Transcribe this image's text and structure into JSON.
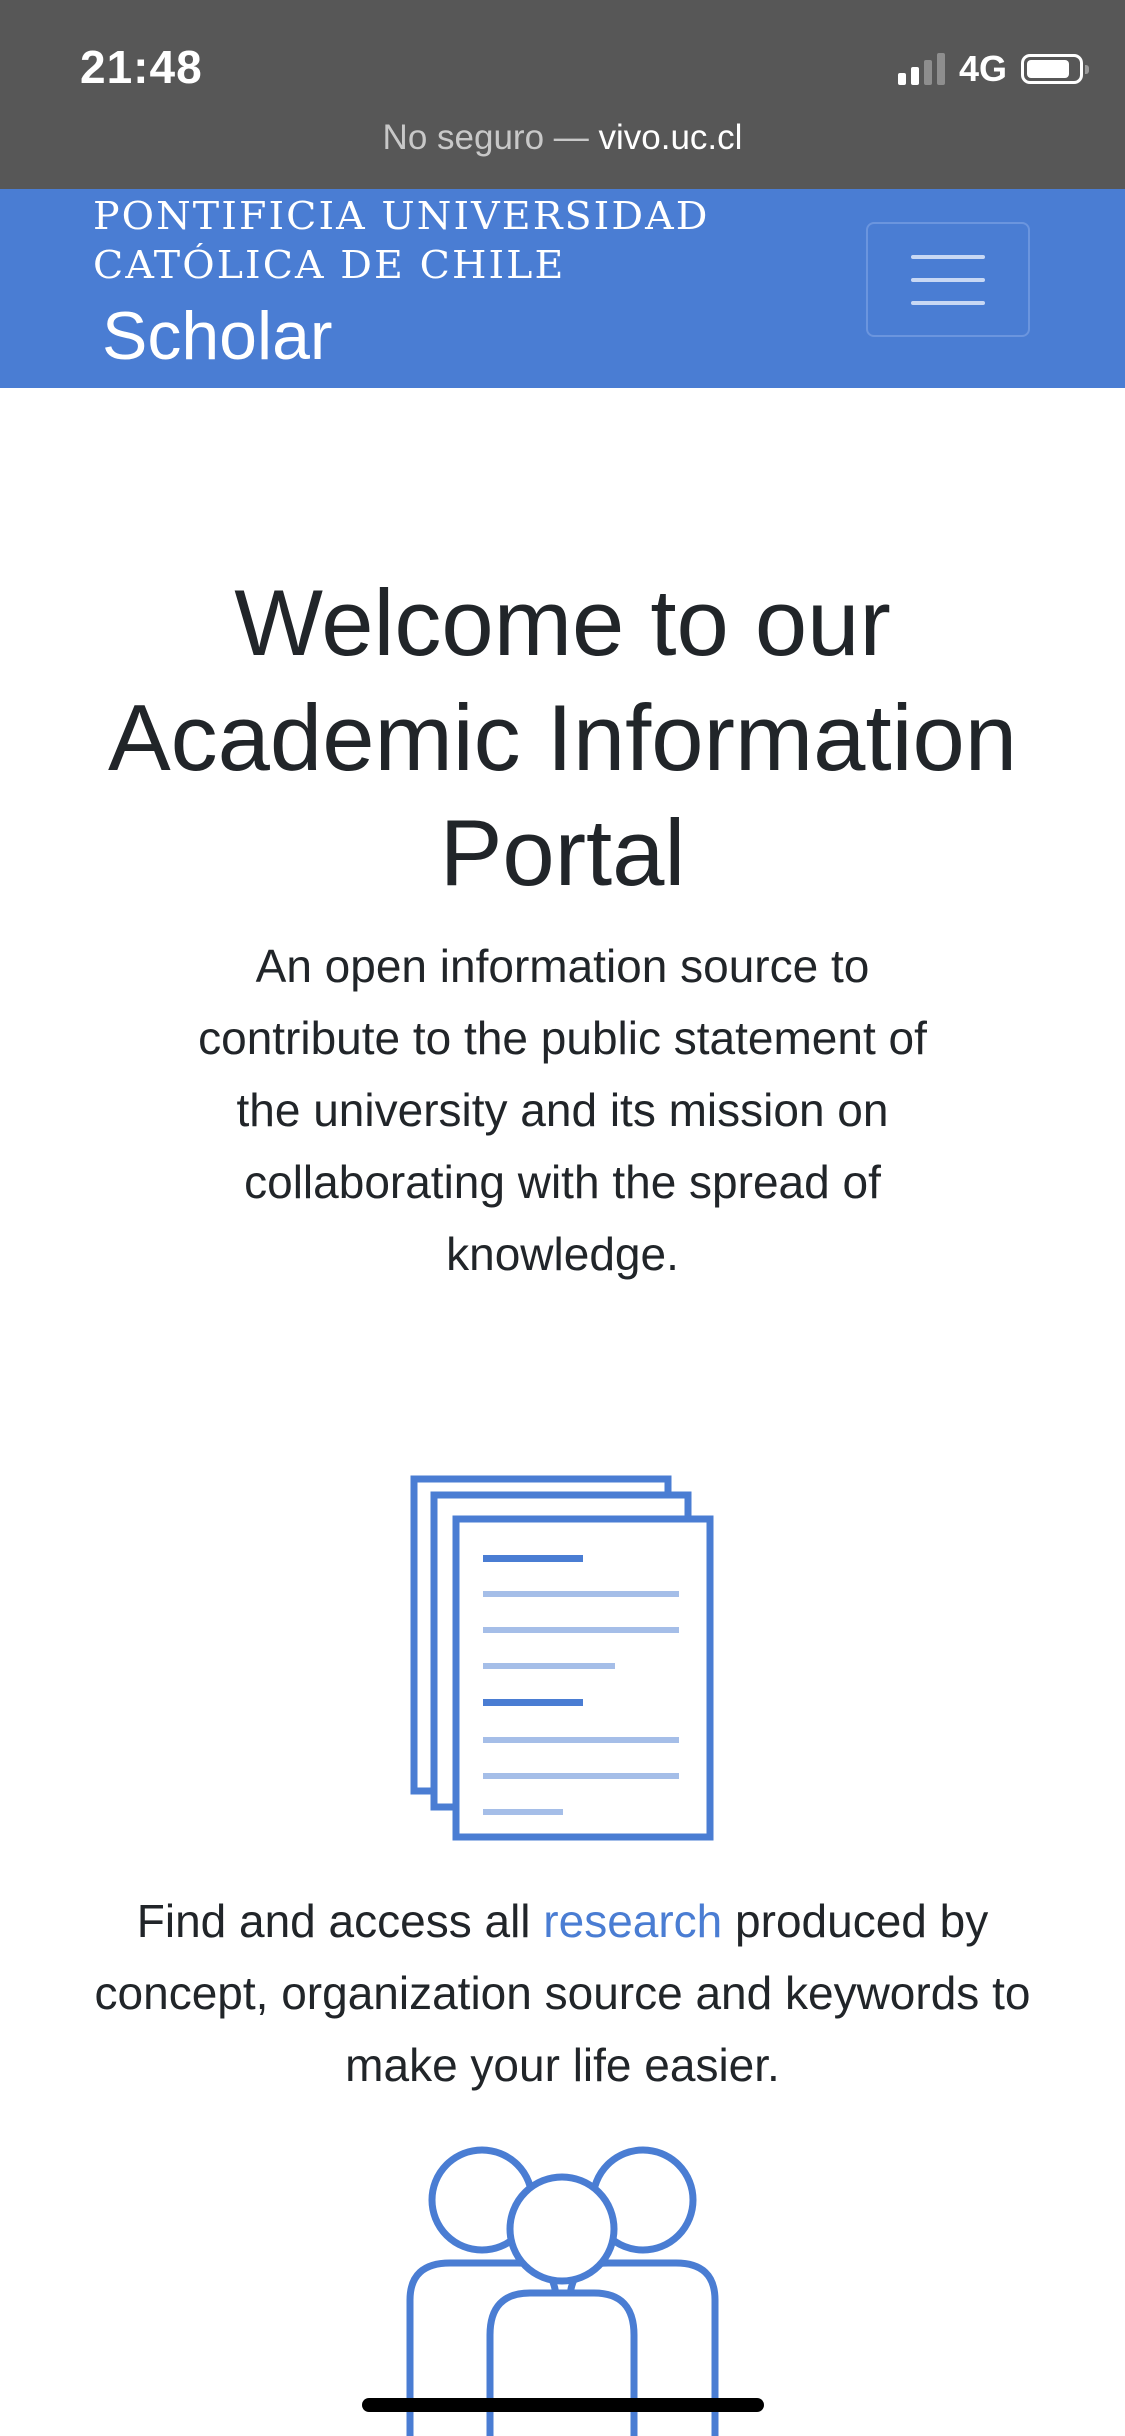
{
  "status_bar": {
    "time": "21:48",
    "network": "4G",
    "signal_bars_active": 2,
    "signal_bars_total": 4,
    "battery_icon": "battery-icon"
  },
  "address_bar": {
    "security_label": "No seguro —",
    "domain": "vivo.uc.cl"
  },
  "navbar": {
    "university_line1": "PONTIFICIA UNIVERSIDAD",
    "university_line2": "CATÓLICA DE CHILE",
    "brand": "Scholar",
    "menu_icon": "hamburger-menu-icon",
    "background": "#4a7dd3"
  },
  "hero": {
    "title_line1": "Welcome to our",
    "title_line2": "Academic Information",
    "title_line3": "Portal",
    "description_line1": "An open information source to",
    "description_line2": "contribute to the public statement of",
    "description_line3": "the university and its mission on",
    "description_line4": "collaborating with the spread of",
    "description_line5": "knowledge."
  },
  "features": {
    "research": {
      "icon": "documents-icon",
      "text_before": "Find and access all",
      "link_text": "research",
      "text_after_line1": "produced by",
      "text_line2": "concept, organization source and keywords to",
      "text_line3": "make your life easier."
    },
    "people": {
      "icon": "people-group-icon"
    }
  },
  "colors": {
    "accent": "#4a7dd3",
    "text": "#212529",
    "status_bar": "#575757"
  }
}
